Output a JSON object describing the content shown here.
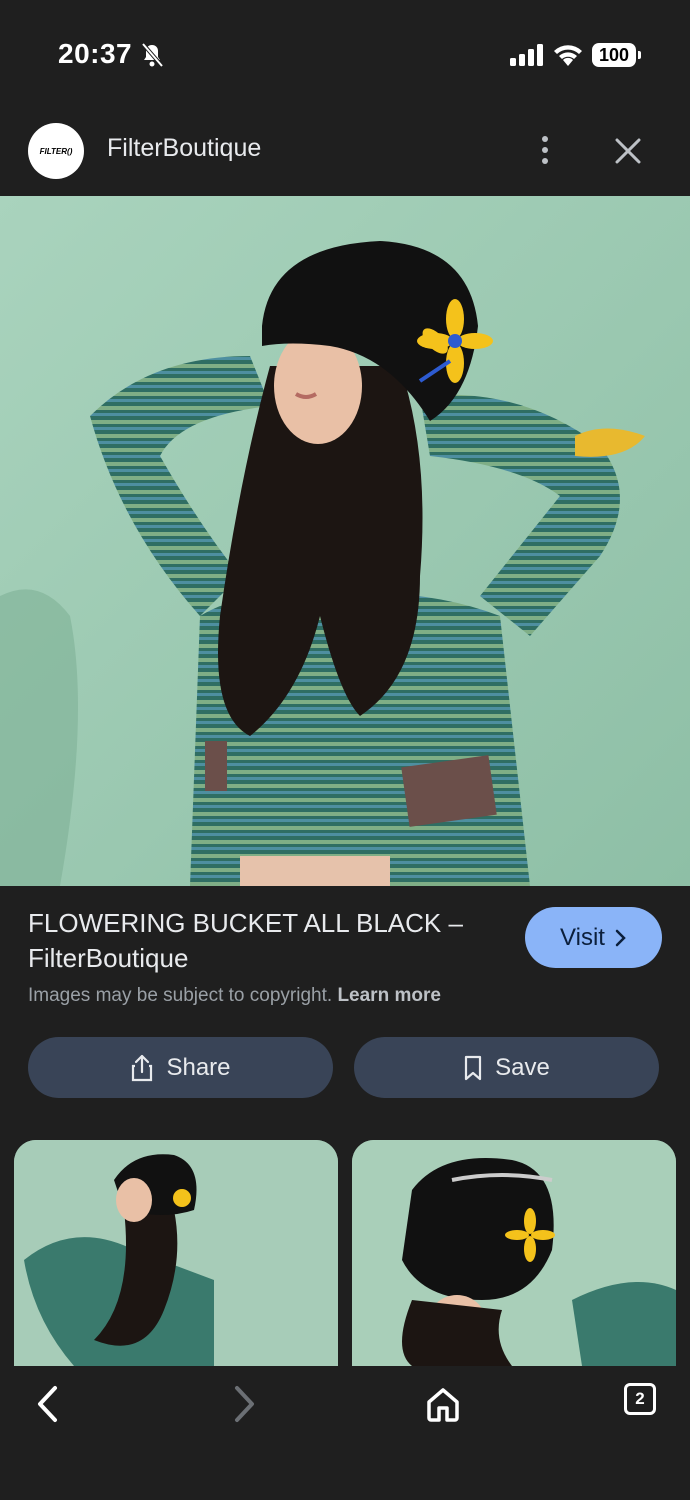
{
  "status_bar": {
    "time": "20:37",
    "battery": "100"
  },
  "header": {
    "avatar_text": "FILTER()",
    "site_name": "FilterBoutique"
  },
  "result": {
    "title": "FLOWERING BUCKET ALL BLACK – FilterBoutique",
    "visit_label": "Visit",
    "copyright_text": "Images may be subject to copyright.",
    "learn_more": "Learn more"
  },
  "actions": {
    "share_label": "Share",
    "save_label": "Save"
  },
  "nav": {
    "tab_count": "2"
  },
  "colors": {
    "background": "#1f1f1f",
    "accent": "#8ab4f8",
    "button_bg": "#394457"
  }
}
